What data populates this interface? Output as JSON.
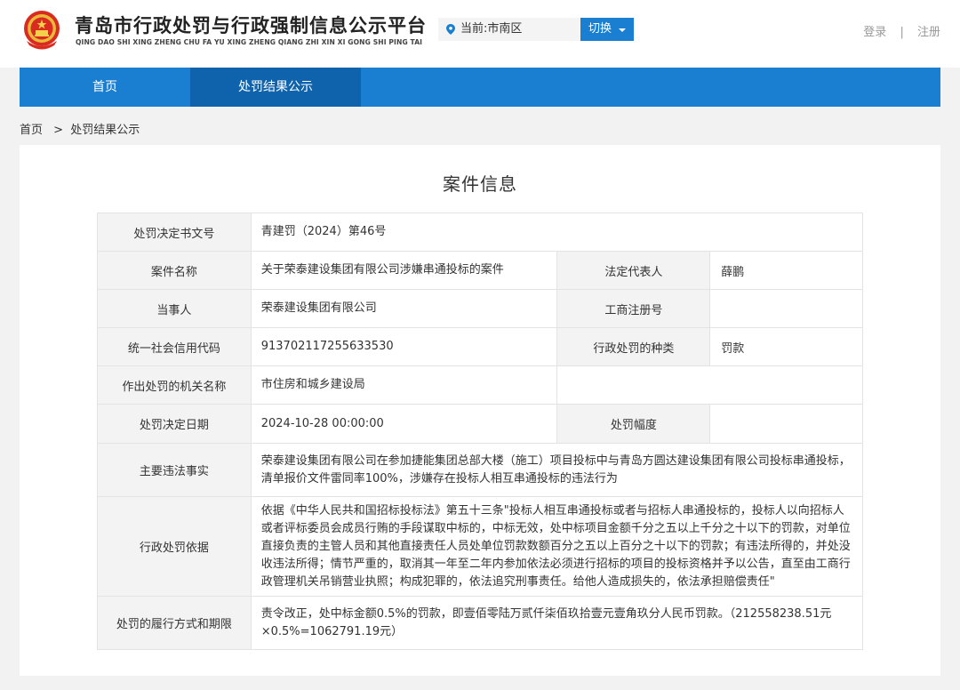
{
  "header": {
    "site_title": "青岛市行政处罚与行政强制信息公示平台",
    "site_pinyin": "QING DAO SHI XING ZHENG CHU FA YU XING ZHENG QIANG ZHI XIN XI GONG SHI PING TAI",
    "region_label": "当前:市南区",
    "switch_label": "切换",
    "login_label": "登录",
    "register_label": "注册",
    "separator": "|"
  },
  "nav": {
    "home_label": "首页",
    "results_label": "处罚结果公示"
  },
  "breadcrumb": {
    "home": "首页",
    "separator": ">",
    "current": "处罚结果公示"
  },
  "case": {
    "title": "案件信息",
    "rows": {
      "doc_no": {
        "label": "处罚决定书文号",
        "value": "青建罚（2024）第46号"
      },
      "case_name": {
        "label": "案件名称",
        "value": "关于荣泰建设集团有限公司涉嫌串通投标的案件"
      },
      "legal_rep": {
        "label": "法定代表人",
        "value": "薛鹏"
      },
      "party": {
        "label": "当事人",
        "value": "荣泰建设集团有限公司"
      },
      "biz_reg_no": {
        "label": "工商注册号",
        "value": ""
      },
      "credit_code": {
        "label": "统一社会信用代码",
        "value": "913702117255633530"
      },
      "penalty_type": {
        "label": "行政处罚的种类",
        "value": "罚款"
      },
      "authority": {
        "label": "作出处罚的机关名称",
        "value": "市住房和城乡建设局"
      },
      "decision_date": {
        "label": "处罚决定日期",
        "value": "2024-10-28 00:00:00"
      },
      "penalty_range": {
        "label": "处罚幅度",
        "value": ""
      },
      "facts": {
        "label": "主要违法事实",
        "value": "荣泰建设集团有限公司在参加捷能集团总部大楼（施工）项目投标中与青岛方圆达建设集团有限公司投标串通投标，清单报价文件雷同率100%，涉嫌存在投标人相互串通投标的违法行为"
      },
      "basis": {
        "label": "行政处罚依据",
        "value": "依据《中华人民共和国招标投标法》第五十三条\"投标人相互串通投标或者与招标人串通投标的，投标人以向招标人或者评标委员会成员行贿的手段谋取中标的，中标无效，处中标项目金额千分之五以上千分之十以下的罚款，对单位直接负责的主管人员和其他直接责任人员处单位罚款数额百分之五以上百分之十以下的罚款；有违法所得的，并处没收违法所得；情节严重的，取消其一年至二年内参加依法必须进行招标的项目的投标资格并予以公告，直至由工商行政管理机关吊销营业执照；构成犯罪的，依法追究刑事责任。给他人造成损失的，依法承担赔偿责任\""
      },
      "fulfillment": {
        "label": "处罚的履行方式和期限",
        "value": "责令改正，处中标金额0.5%的罚款，即壹佰零陆万贰仟柒佰玖拾壹元壹角玖分人民币罚款。（212558238.51元×0.5%=1062791.19元）"
      }
    }
  },
  "colors": {
    "primary": "#1a7fd0",
    "nav_active": "#0f63ad",
    "label_bg": "#f3f3f3",
    "page_bg": "#f2f2f2"
  },
  "icons": {
    "emblem": "national-emblem-icon",
    "location": "location-pin-icon",
    "dropdown": "caret-down-icon"
  }
}
